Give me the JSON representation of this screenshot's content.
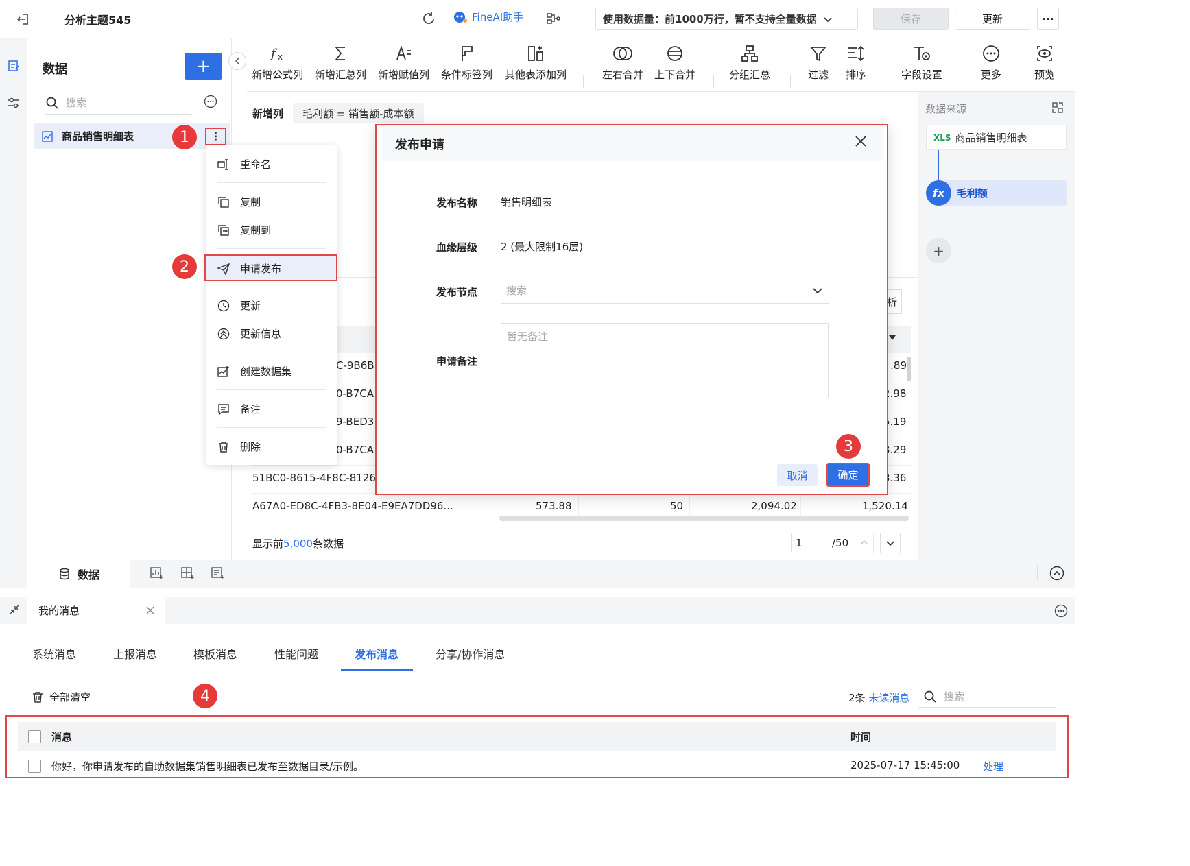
{
  "topbar": {
    "title": "分析主题545",
    "fineai_label": "FineAI助手",
    "scope_label": "使用数据量：前1000万行，暂不支持全量数据",
    "save_label": "保存",
    "update_label": "更新",
    "more_label": "···"
  },
  "data_panel": {
    "title": "数据",
    "search_placeholder": "搜索",
    "dataset_name": "商品销售明细表"
  },
  "badges": [
    "1",
    "2",
    "3",
    "4"
  ],
  "context_menu": {
    "items": [
      "重命名",
      "复制",
      "复制到",
      "申请发布",
      "更新",
      "更新信息",
      "创建数据集",
      "备注",
      "删除"
    ]
  },
  "toolbar": {
    "items": [
      "新增公式列",
      "新增汇总列",
      "新增赋值列",
      "条件标签列",
      "其他表添加列",
      "左右合并",
      "上下合并",
      "分组汇总",
      "过滤",
      "排序",
      "字段设置",
      "更多",
      "预览"
    ]
  },
  "new_column": {
    "label": "新增列",
    "formula": "毛利额 = 销售额-成本额"
  },
  "table": {
    "analyze_fragment": "析",
    "left_fragments": [
      "C-9B6B",
      "0-B7CA",
      "9-BED3",
      "0-B7CA",
      "51BC0-8615-4F8C-8126-",
      "A67A0-ED8C-4FB3-8E04-E9EA7DD96..."
    ],
    "right_values": [
      ".89",
      "2.98",
      "5.19",
      "3.29",
      "3.36",
      "1,520.14"
    ],
    "last_row": [
      "573.88",
      "50",
      "2,094.02"
    ],
    "footnote_prefix": "显示前",
    "footnote_count": "5,000",
    "footnote_suffix": "条数据",
    "page_current": "1",
    "page_total": "/50"
  },
  "source_panel": {
    "title": "数据来源",
    "source_name": "商品销售明细表",
    "source_icon_text": "XLS",
    "fx_label": "毛利额",
    "fx_icon_text": "fx"
  },
  "dialog": {
    "title": "发布申请",
    "fields": [
      {
        "label": "发布名称",
        "value": "销售明细表"
      },
      {
        "label": "血缘层级",
        "value": "2 (最大限制16层)"
      },
      {
        "label": "发布节点",
        "placeholder": "搜索"
      },
      {
        "label": "申请备注",
        "placeholder": "暂无备注"
      }
    ],
    "cancel_label": "取消",
    "ok_label": "确定"
  },
  "bottom": {
    "data_tab": "数据"
  },
  "messages": {
    "tab_title": "我的消息",
    "tabs": [
      "系统消息",
      "上报消息",
      "模板消息",
      "性能问题",
      "发布消息",
      "分享/协作消息"
    ],
    "active_tab": "发布消息",
    "clear_all": "全部清空",
    "unread_count": "2条",
    "unread_label": "未读消息",
    "search_placeholder": "搜索",
    "col_message": "消息",
    "col_time": "时间",
    "rows": [
      {
        "message": "你好，你申请发布的自助数据集销售明细表已发布至数据目录/示例。",
        "time": "2025-07-17 15:45:00",
        "action": "处理"
      }
    ]
  },
  "colors": {
    "accent": "#2f6fe4",
    "highlight_red": "#e04848",
    "badge_red": "#e63a3a"
  }
}
